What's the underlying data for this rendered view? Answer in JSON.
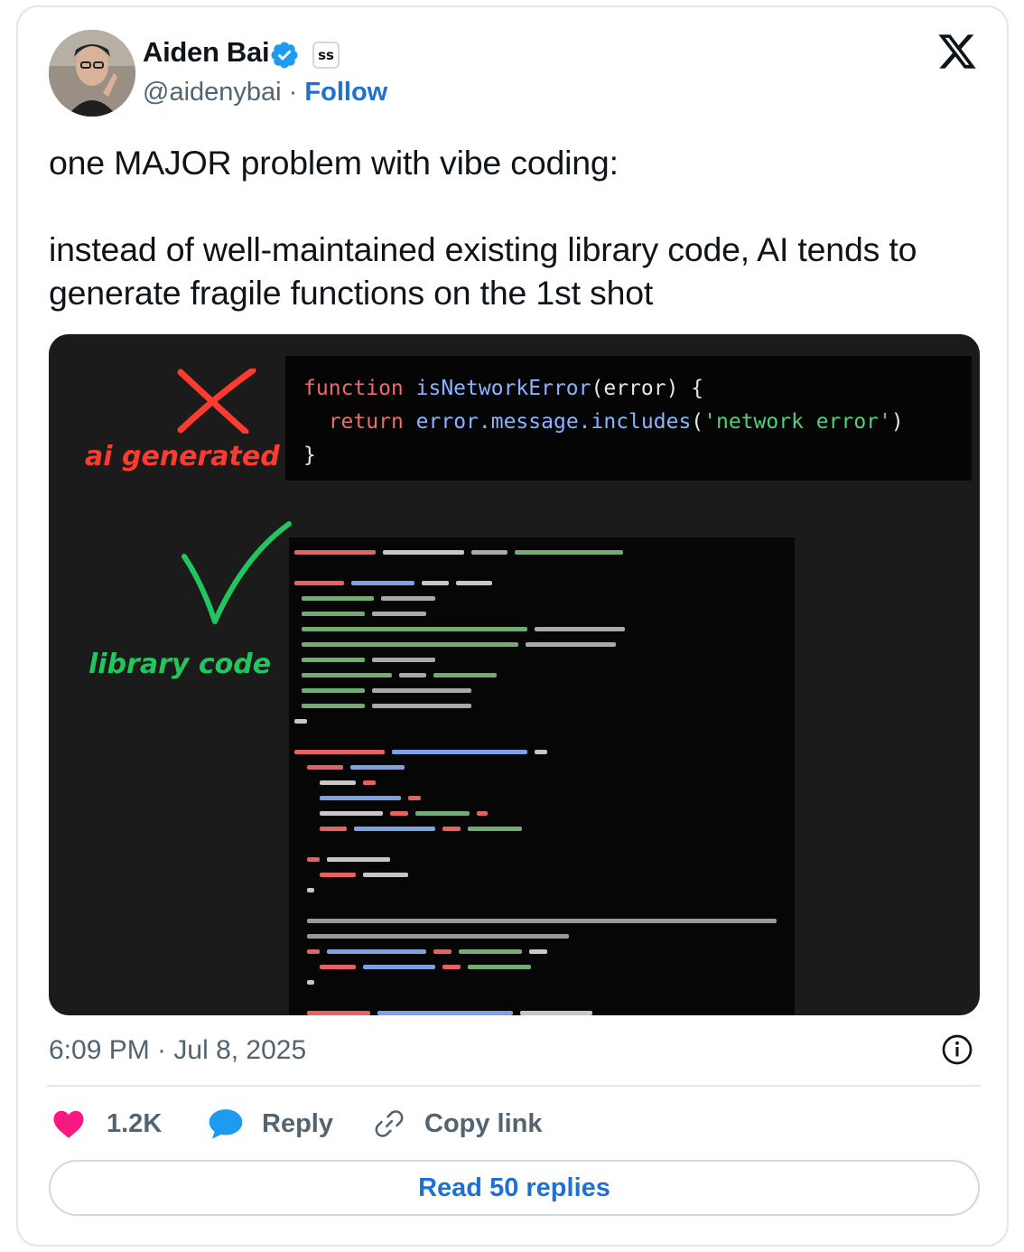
{
  "author": {
    "name": "Aiden Bai",
    "handle": "@aidenybai",
    "separator": "·",
    "follow_label": "Follow",
    "affiliate_badge": "ss"
  },
  "tweet": {
    "line1": "one MAJOR problem with vibe coding:",
    "line2": "instead of well-maintained existing library code, AI tends to generate fragile functions on the 1st shot"
  },
  "media": {
    "ai_label": "ai generated",
    "library_label": "library code",
    "code_top": {
      "line1_kw": "function",
      "line1_fn": "isNetworkError",
      "line1_rest": "(error) {",
      "line2_kw": "return",
      "line2_fn": "error.message.includes",
      "line2_open": "(",
      "line2_str": "'network error'",
      "line2_close": ")",
      "line3": "}"
    }
  },
  "timestamp": "6:09 PM · Jul 8, 2025",
  "actions": {
    "likes": "1.2K",
    "reply_label": "Reply",
    "copy_label": "Copy link"
  },
  "read_replies_label": "Read 50 replies",
  "icons": [
    "verified-icon",
    "x-logo-icon",
    "info-icon",
    "heart-icon",
    "reply-bubble-icon",
    "link-icon"
  ],
  "colors": {
    "link_blue": "#1d70d6",
    "heart": "#f91880",
    "reply_blue": "#1d9bf0",
    "red_mark": "#ff3b30",
    "green_mark": "#22c55e"
  }
}
